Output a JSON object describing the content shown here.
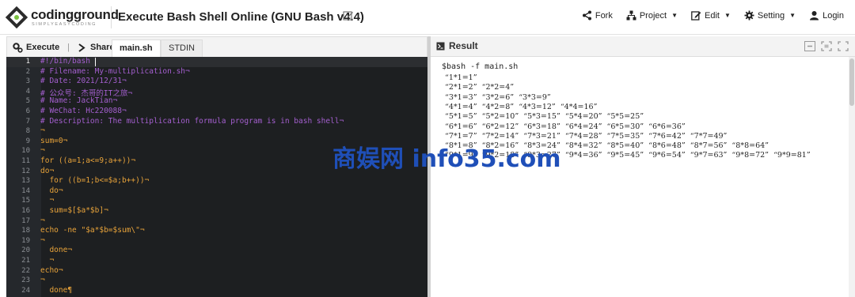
{
  "header": {
    "logo_text": "codingground",
    "logo_tagline": "SIMPLYEASYCODING",
    "title": "Execute Bash Shell Online (GNU Bash v4.4)",
    "nav": [
      {
        "label": "Fork",
        "icon": "fork-icon"
      },
      {
        "label": "Project",
        "icon": "project-icon"
      },
      {
        "label": "Edit",
        "icon": "edit-icon"
      },
      {
        "label": "Setting",
        "icon": "gear-icon"
      },
      {
        "label": "Login",
        "icon": "user-icon"
      }
    ]
  },
  "toolbar": {
    "execute_label": "Execute",
    "share_label": "Share",
    "tabs": [
      "main.sh",
      "STDIN"
    ]
  },
  "editor": {
    "line_numbers": [
      "1",
      "2",
      "3",
      "4",
      "5",
      "6",
      "7",
      "8",
      "9",
      "10",
      "11",
      "12",
      "13",
      "14",
      "15",
      "16",
      "17",
      "18",
      "19",
      "20",
      "21",
      "22",
      "23",
      "24"
    ],
    "lines": [
      "#!/bin/bash",
      "# Filename: My-multiplication.sh¬",
      "# Date: 2021/12/31¬",
      "# 公众号: 杰哥的IT之旅¬",
      "# Name: JackTian¬",
      "# WeChat: Hc220088¬",
      "# Description: The multiplication formula program is in bash shell¬",
      "¬",
      "sum=0¬",
      "¬",
      "for ((a=1;a<=9;a++))¬",
      "do¬",
      "  for ((b=1;b<=$a;b++))¬",
      "  do¬",
      "  ¬",
      "  sum=$[$a*$b]¬",
      "¬",
      "echo -ne \"$a*$b=$sum\\\"¬",
      "¬",
      "  done¬",
      "  ¬",
      "echo¬",
      "¬",
      "  done¶"
    ]
  },
  "result": {
    "title": "Result",
    "command": "$bash -f main.sh",
    "output": [
      "“1*1=1”",
      "“2*1=2”  “2*2=4”",
      "“3*1=3”  “3*2=6”  “3*3=9”",
      "“4*1=4”  “4*2=8”  “4*3=12”  “4*4=16”",
      "“5*1=5”  “5*2=10”  “5*3=15”  “5*4=20”  “5*5=25”",
      "“6*1=6”  “6*2=12”  “6*3=18”  “6*4=24”  “6*5=30”  “6*6=36”",
      "“7*1=7”  “7*2=14”  “7*3=21”  “7*4=28”  “7*5=35”  “7*6=42”  “7*7=49”",
      "“8*1=8”  “8*2=16”  “8*3=24”  “8*4=32”  “8*5=40”  “8*6=48”  “8*7=56”  “8*8=64”",
      "“9*1=9”  “9*2=18”  “9*3=27”  “9*4=36”  “9*5=45”  “9*6=54”  “9*7=63”  “9*8=72”  “9*9=81”"
    ]
  },
  "watermark": "商娱网 info35.com",
  "colors": {
    "editor_bg": "#1d1f21",
    "comment": "#a45fcf",
    "keyword": "#e8a33a",
    "watermark": "#1f4fb8"
  }
}
